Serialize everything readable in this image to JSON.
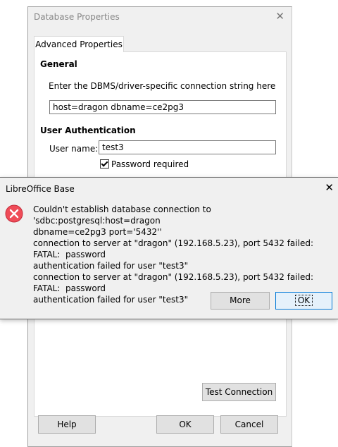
{
  "background_dialog": {
    "title": "Database Properties",
    "tab": "Advanced Properties",
    "general_heading": "General",
    "connection_hint": "Enter the DBMS/driver-specific connection string here",
    "connection_value": "host=dragon dbname=ce2pg3",
    "auth_heading": "User Authentication",
    "username_label": "User name:",
    "username_value": "test3",
    "password_required_label": "Password required",
    "password_required_checked": true,
    "test_connection_label": "Test Connection",
    "help_label": "Help",
    "ok_label": "OK",
    "cancel_label": "Cancel"
  },
  "alert": {
    "title": "LibreOffice Base",
    "icon": "error-icon",
    "message_lines": [
      "Couldn't establish database connection to 'sdbc:postgresql:host=dragon",
      "dbname=ce2pg3 port='5432''",
      "connection to server at \"dragon\" (192.168.5.23), port 5432 failed: FATAL:  password",
      "authentication failed for user \"test3\"",
      "connection to server at \"dragon\" (192.168.5.23), port 5432 failed: FATAL:  password",
      "authentication failed for user \"test3\""
    ],
    "more_label": "More",
    "ok_label": "OK"
  },
  "colors": {
    "dialog_bg": "#f0f0f0",
    "error_red": "#e81123",
    "default_button_border": "#0078d7"
  }
}
